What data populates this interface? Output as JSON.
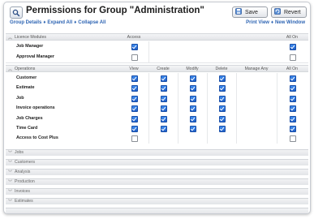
{
  "header": {
    "title": "Permissions for Group \"Administration\"",
    "save_label": "Save",
    "revert_label": "Revert",
    "links_left": [
      "Group Details",
      "Expand All",
      "Collapse All"
    ],
    "links_right": [
      "Print View",
      "New Window"
    ]
  },
  "licence_section": {
    "title": "Licence Modules",
    "columns": [
      "Access",
      "All On"
    ],
    "rows": [
      {
        "label": "Job Manager",
        "access": true,
        "all_on": true
      },
      {
        "label": "Approval Manager",
        "access": false,
        "all_on": false
      }
    ]
  },
  "operations_section": {
    "title": "Operations",
    "columns": [
      "View",
      "Create",
      "Modify",
      "Delete",
      "Manage Any",
      "All On"
    ],
    "rows": [
      {
        "label": "Customer",
        "view": true,
        "create": true,
        "modify": true,
        "delete": true,
        "all_on": true
      },
      {
        "label": "Estimate",
        "view": true,
        "create": true,
        "modify": true,
        "delete": true,
        "all_on": true
      },
      {
        "label": "Job",
        "view": true,
        "create": true,
        "modify": true,
        "delete": true,
        "all_on": true
      },
      {
        "label": "Invoice operations",
        "view": true,
        "create": true,
        "modify": true,
        "delete": true,
        "all_on": true
      },
      {
        "label": "Job Charges",
        "view": true,
        "create": true,
        "modify": true,
        "delete": true,
        "all_on": true
      },
      {
        "label": "Time Card",
        "view": true,
        "create": true,
        "modify": true,
        "delete": true,
        "all_on": true
      },
      {
        "label": "Access to Cost Plus",
        "view": false,
        "all_on": false
      }
    ]
  },
  "collapsed_sections": [
    "Jobs",
    "Customers",
    "Analysis",
    "Production",
    "Invoices",
    "Estimates"
  ],
  "icons": {
    "title": "magnifier-icon",
    "save": "floppy-disk-icon",
    "revert": "revert-icon",
    "expanded": "chevron-up-icon",
    "collapsed": "chevron-down-icon"
  },
  "colors": {
    "link": "#2d64b3",
    "checkbox_on": "#2a6fdb"
  }
}
